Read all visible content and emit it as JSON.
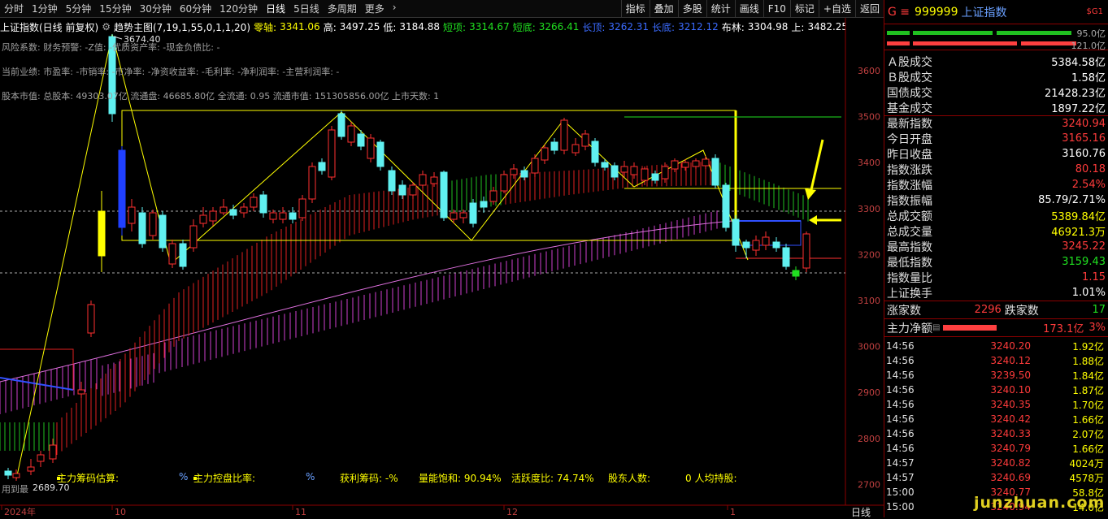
{
  "toolbar": {
    "periods": [
      "分时",
      "1分钟",
      "5分钟",
      "15分钟",
      "30分钟",
      "60分钟",
      "120分钟",
      "日线",
      "5日线",
      "多周期",
      "更多"
    ],
    "active_period": "日线",
    "right_buttons": [
      "指标",
      "叠加",
      "多股",
      "统计",
      "画线",
      "F10",
      "标记",
      "+自选",
      "返回"
    ]
  },
  "info": {
    "index_name": "上证指数(日线 前复权)",
    "indicator": "趋势主图(7,19,1,55,0,1,1,20)",
    "zero_axis_label": "零轴:",
    "zero_axis": "3341.06",
    "high_label": "高:",
    "high": "3497.25",
    "low_label": "低:",
    "low": "3184.88",
    "short_label": "短项:",
    "short": "3314.67",
    "short_bottom_label": "短底:",
    "short_bottom": "3266.41",
    "long_label": "长顶:",
    "long": "3262.31",
    "long_bottom_label": "长底:",
    "long_bottom": "3212.12",
    "boll_label": "布林:",
    "boll": "3304.98",
    "upper_label": "上:",
    "upper": "3482.25",
    "lower_label": "下:"
  },
  "overlay": {
    "risk": "风险系数: 财务预警: -Z值: -优质资产率: -现金负债比: -",
    "current_perf": "当前业绩: 市盈率: -市销率: -市净率: -净资收益率: -毛利率: -净利润率: -主营利润率: -",
    "stock_value": "股本市值: 总股本: 49303.07亿 流通盘: 46685.80亿 全流通: 0.95 流通市值: 151305856.00亿 上市天数: 1",
    "peak_label": "3674.40",
    "low_label": "2689.70",
    "bottom_left": "用到最"
  },
  "bottom_indicators": {
    "main_chip": "主力筹码估算:",
    "pct1": "%",
    "main_control": "主力控盘比率:",
    "pct2": "%",
    "profit_chip": "获利筹码: -%",
    "energy": "量能饱和: 90.94%",
    "activity": "活跃度比: 74.74%",
    "holders": "股东人数:",
    "per_holding": "0 人均持股:"
  },
  "x_axis": [
    "2024年",
    "10",
    "11",
    "12",
    "1"
  ],
  "y_axis": [
    "3600",
    "3500",
    "3400",
    "3300",
    "3200",
    "3100",
    "3000",
    "2900",
    "2800",
    "2700"
  ],
  "corner_label": "日线",
  "right_panel": {
    "code_prefix": "G ≡",
    "code": "999999",
    "name": "上证指数",
    "badge": "$G1",
    "bar_vals": [
      "95.0亿",
      "121.0亿"
    ],
    "stats": [
      {
        "label": "Ａ股成交",
        "value": "5384.58亿",
        "color": "white"
      },
      {
        "label": "Ｂ股成交",
        "value": "1.58亿",
        "color": "white"
      },
      {
        "label": "国债成交",
        "value": "21428.23亿",
        "color": "white"
      },
      {
        "label": "基金成交",
        "value": "1897.22亿",
        "color": "white"
      },
      {
        "label": "最新指数",
        "value": "3240.94",
        "color": "red"
      },
      {
        "label": "今日开盘",
        "value": "3165.16",
        "color": "red"
      },
      {
        "label": "昨日收盘",
        "value": "3160.76",
        "color": "white"
      },
      {
        "label": "指数涨跌",
        "value": "80.18",
        "color": "red"
      },
      {
        "label": "指数涨幅",
        "value": "2.54%",
        "color": "red"
      },
      {
        "label": "指数振幅",
        "value": "85.79/2.71%",
        "color": "white"
      },
      {
        "label": "总成交额",
        "value": "5389.84亿",
        "color": "yellow"
      },
      {
        "label": "总成交量",
        "value": "46921.3万",
        "color": "yellow"
      },
      {
        "label": "最高指数",
        "value": "3245.22",
        "color": "red"
      },
      {
        "label": "最低指数",
        "value": "3159.43",
        "color": "green"
      },
      {
        "label": "指数量比",
        "value": "1.15",
        "color": "red"
      },
      {
        "label": "上证换手",
        "value": "1.01%",
        "color": "white"
      }
    ],
    "rise_label": "涨家数",
    "rise": "2296",
    "fall_label": "跌家数",
    "fall": "17",
    "net_label": "主力净额",
    "net": "173.1亿",
    "net_pct": "3%",
    "trades": [
      {
        "t": "14:56",
        "p": "3240.20",
        "v": "1.92亿",
        "c": "yellow"
      },
      {
        "t": "14:56",
        "p": "3240.12",
        "v": "1.88亿",
        "c": "yellow"
      },
      {
        "t": "14:56",
        "p": "3239.50",
        "v": "1.84亿",
        "c": "yellow"
      },
      {
        "t": "14:56",
        "p": "3240.10",
        "v": "1.87亿",
        "c": "yellow"
      },
      {
        "t": "14:56",
        "p": "3240.35",
        "v": "1.70亿",
        "c": "yellow"
      },
      {
        "t": "14:56",
        "p": "3240.42",
        "v": "1.66亿",
        "c": "yellow"
      },
      {
        "t": "14:56",
        "p": "3240.33",
        "v": "2.07亿",
        "c": "yellow"
      },
      {
        "t": "14:56",
        "p": "3240.79",
        "v": "1.66亿",
        "c": "yellow"
      },
      {
        "t": "14:57",
        "p": "3240.82",
        "v": "4024万",
        "c": "yellow"
      },
      {
        "t": "14:57",
        "p": "3240.69",
        "v": "4578万",
        "c": "yellow"
      },
      {
        "t": "15:00",
        "p": "3240.77",
        "v": "58.8亿",
        "c": "yellow"
      },
      {
        "t": "15:00",
        "p": "3240.94",
        "v": "14.0亿",
        "c": "yellow"
      }
    ],
    "watermark": "junzhuan.com"
  }
}
